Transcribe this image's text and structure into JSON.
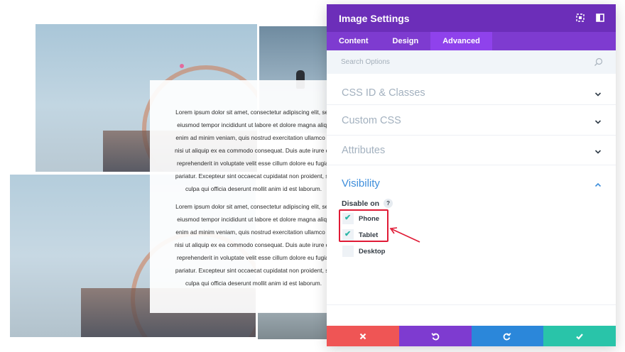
{
  "preview": {
    "lorem_paragraph_1": [
      "Lorem ipsum dolor sit amet, consectetur adipiscing elit, sed",
      "eiusmod tempor incididunt ut labore et dolore magna aliqu",
      "enim ad minim veniam, quis nostrud exercitation ullamco la",
      "nisi ut aliquip ex ea commodo consequat. Duis aute irure do",
      "reprehenderit in voluptate velit esse cillum dolore eu fugiat",
      "pariatur. Excepteur sint occaecat cupidatat non proident, su",
      "culpa qui officia deserunt mollit anim id est laborum."
    ],
    "lorem_paragraph_2": [
      "Lorem ipsum dolor sit amet, consectetur adipiscing elit, sed",
      "eiusmod tempor incididunt ut labore et dolore magna aliqu",
      "enim ad minim veniam, quis nostrud exercitation ullamco la",
      "nisi ut aliquip ex ea commodo consequat. Duis aute irure do",
      "reprehenderit in voluptate velit esse cillum dolore eu fugiat",
      "pariatur. Excepteur sint occaecat cupidatat non proident, su",
      "culpa qui officia deserunt mollit anim id est laborum."
    ]
  },
  "modal": {
    "title": "Image Settings",
    "header_icons": [
      "expand-icon",
      "sidebar-toggle-icon"
    ],
    "tabs": [
      {
        "label": "Content",
        "active": false
      },
      {
        "label": "Design",
        "active": false
      },
      {
        "label": "Advanced",
        "active": true
      }
    ],
    "search": {
      "placeholder": "Search Options",
      "value": ""
    },
    "sections": {
      "css_id_classes": "CSS ID & Classes",
      "custom_css": "Custom CSS",
      "attributes": "Attributes",
      "visibility": "Visibility"
    },
    "visibility": {
      "disable_on_label": "Disable on",
      "help": "?",
      "options": [
        {
          "label": "Phone",
          "checked": true
        },
        {
          "label": "Tablet",
          "checked": true
        },
        {
          "label": "Desktop",
          "checked": false
        }
      ],
      "check_glyph": "✔"
    },
    "footer": {
      "buttons": [
        "cancel-icon",
        "undo-icon",
        "redo-icon",
        "save-check-icon"
      ]
    }
  },
  "colors": {
    "header": "#6c2eb9",
    "tabs": "#7e3bd0",
    "active_tab": "#8f42ec",
    "visibility_title": "#3e8edb",
    "checkmark": "#2bb5a6",
    "annotation": "#e01b36",
    "cancel": "#ef5555",
    "undo": "#7e3bd0",
    "redo": "#2b87da",
    "save": "#29c4a9"
  }
}
